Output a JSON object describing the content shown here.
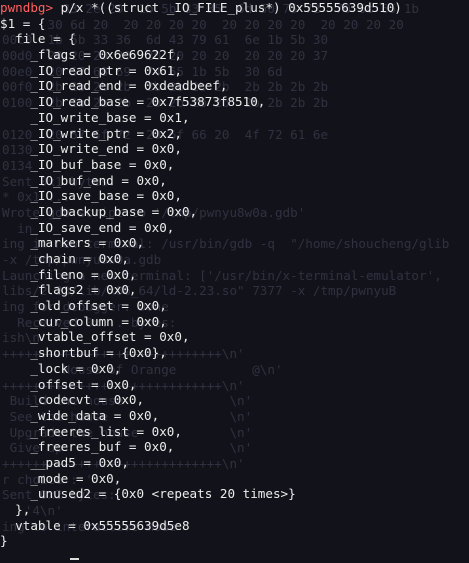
{
  "terminal": {
    "prompt": "pwndbg>",
    "command": " p/x *((struct _IO_FILE_plus*) 0x55555639d510)",
    "output": [
      "$1 = {",
      "  file = {",
      "    _flags = 0x6e69622f,",
      "    _IO_read_ptr = 0x61,",
      "    _IO_read_end = 0xdeadbeef,",
      "    _IO_read_base = 0x7f53873f8510,",
      "    _IO_write_base = 0x1,",
      "    _IO_write_ptr = 0x2,",
      "    _IO_write_end = 0x0,",
      "    _IO_buf_base = 0x0,",
      "    _IO_buf_end = 0x0,",
      "    _IO_save_base = 0x0,",
      "    _IO_backup_base = 0x0,",
      "    _IO_save_end = 0x0,",
      "    _markers = 0x0,",
      "    _chain = 0x0,",
      "    _fileno = 0x0,",
      "    _flags2 = 0x0,",
      "    _old_offset = 0x0,",
      "    _cur_column = 0x0,",
      "    _vtable_offset = 0x0,",
      "    _shortbuf = {0x0},",
      "    _lock = 0x0,",
      "    _offset = 0x0,",
      "    _codecvt = 0x0,",
      "    _wide_data = 0x0,",
      "    _freeres_list = 0x0,",
      "    _freeres_buf = 0x0,",
      "    __pad5 = 0x0,",
      "    _mode = 0x0,",
      "    _unused2 = {0x0 <repeats 20 times>}",
      "  },",
      "  vtable = 0x55555639d5e8",
      "}"
    ],
    "background_lines": [
      "        33 2e 20  1b 5b 33 35  6d 50 75 72  70 6c 65 1b",
      "      30 6d 20  20 20 20 20  20 20 20 20  20 20 20 20",
      "00c0  1b 5b 33 36  6d 43 79 61  6e 1b 5b 30",
      "00d0  20 20 20 20  20 20 20 20  20 20 20 37",
      "00e0  20 57 68 69  74 65 1b 5b  30 6d",
      "00f0  2b 2b 2b 2b  2b 2b 2b 2b  2b 2b 2b 2b",
      "0100  2b 2b 2b 2b  2b 2b 2b 2b  2b 2b 2b 2b",
      "",
      "0120  20 57 6f 72  20 6f 66 20  4f 72 61 6e",
      "0130",
      "0134",
      "Sent 0x1 bytes:",
      "* 0x1 ...",
      "Wrote gdb script to '/tmp/pwnyu8w0a.gdb'",
      "  in",
      "ing in new terminal: /usr/bin/gdb -q  \"/home/shoucheng/glib",
      "-x /tmp/pwnyu8w0a.gdb",
      "Launching a new terminal: ['/usr/bin/x-terminal-emulator',",
      "libs/2.23/lib/x86_64/ld-2.23.so\" 7377 -x /tmp/pwnyuB",
      "ing for debugger: Done",
      "  Received 0x... bytes:",
      "ish\\n'",
      "+++++++++++++++++++++++++++++\\n'",
      "        House of Orange          @\\n'",
      "+++++++++++++++++++++++++++++\\n'",
      " Build the house              \\n'",
      " See the house                \\n'",
      " Upgrade the house            \\n'",
      " Give up                      \\n'",
      "+++++++++++++++++++++++++++++\\n'",
      "r choice : '",
      "Sent 0x2 bytes:",
      "   '4\\n'",
      "ing to interactive mode",
      ""
    ]
  }
}
